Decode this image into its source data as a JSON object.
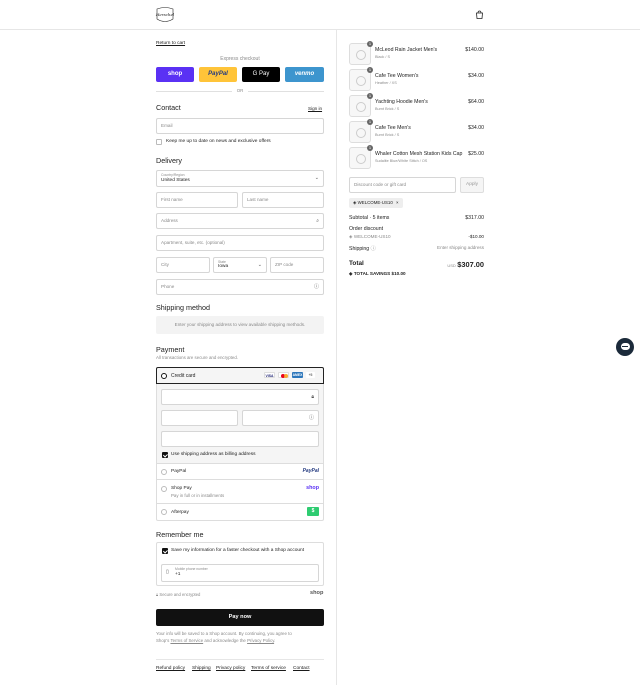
{
  "header": {
    "logo_text": "Herschel",
    "cart_icon": "bag-icon"
  },
  "nav": {
    "return_link": "Return to cart"
  },
  "express": {
    "label": "Express checkout",
    "buttons": {
      "shop": "shop",
      "paypal": "PayPal",
      "gpay": "G Pay",
      "venmo": "venmo"
    },
    "divider": "OR"
  },
  "contact": {
    "title": "Contact",
    "sign_in": "Sign in",
    "email_placeholder": "Email",
    "newsletter_label": "Keep me up to date on news and exclusive offers"
  },
  "delivery": {
    "title": "Delivery",
    "country_label": "Country/Region",
    "country_value": "United States",
    "first_name": "First name",
    "last_name": "Last name",
    "address": "Address",
    "apartment": "Apartment, suite, etc. (optional)",
    "city": "City",
    "state_label": "State",
    "state_value": "Iowa",
    "zip": "ZIP code",
    "phone": "Phone"
  },
  "shipping_method": {
    "title": "Shipping method",
    "notice": "Enter your shipping address to view available shipping methods."
  },
  "payment": {
    "title": "Payment",
    "subtitle": "All transactions are secure and encrypted.",
    "credit_card": "Credit card",
    "card_badges": [
      "VISA",
      "MC",
      "AMEX",
      "+5"
    ],
    "billing_same": "Use shipping address as billing address",
    "paypal": "PayPal",
    "paypal_logo": "PayPal",
    "shop_pay": "Shop Pay",
    "shop_pay_sub": "Pay in full or in installments",
    "shop_logo": "shop",
    "afterpay": "Afterpay",
    "afterpay_logo": "$"
  },
  "remember": {
    "title": "Remember me",
    "save_label": "Save my information for a faster checkout with a Shop account",
    "mobile_label": "Mobile phone number",
    "mobile_value": "+1",
    "secure_note": "Secure and encrypted",
    "shop_mark": "shop"
  },
  "pay_button": "Pay now",
  "legal": {
    "line1": "Your info will be saved to a Shop account. By continuing, you agree to",
    "line2_pre": "Shop's ",
    "terms": "Terms of Service",
    "line2_mid": " and acknowledge the ",
    "privacy": "Privacy Policy",
    "line2_end": "."
  },
  "footer_links": [
    "Refund policy",
    "Shipping",
    "Privacy policy",
    "Terms of service",
    "Contact"
  ],
  "cart": {
    "items": [
      {
        "name": "McLeod Rain Jacket Men's",
        "variant": "Black / S",
        "price": "$140.00",
        "qty": "1"
      },
      {
        "name": "Cafe Tee Women's",
        "variant": "Heather / XS",
        "price": "$34.00",
        "qty": "1"
      },
      {
        "name": "Yachting Hoodie Men's",
        "variant": "Burnt Brick / S",
        "price": "$64.00",
        "qty": "1"
      },
      {
        "name": "Cafe Tee Men's",
        "variant": "Burnt Brick / S",
        "price": "$34.00",
        "qty": "1"
      },
      {
        "name": "Whaler Cotton Mesh Station Kids Cap",
        "variant": "Sudalite Blue/White Stitch / OS",
        "price": "$25.00",
        "qty": "1"
      }
    ],
    "discount_placeholder": "Discount code or gift card",
    "apply": "Apply",
    "code_tag": "WELCOME-US10",
    "subtotal_label": "Subtotal · 5 items",
    "subtotal": "$317.00",
    "order_discount": "Order discount",
    "discount_code": "WELCOME-US10",
    "discount_amount": "-$10.00",
    "shipping_label": "Shipping",
    "shipping_value": "Enter shipping address",
    "total_label": "Total",
    "currency": "USD",
    "total": "$307.00",
    "savings_label": "TOTAL SAVINGS",
    "savings": "$10.00"
  },
  "chat_icon": "chat-bubble-icon",
  "colors": {
    "shop": "#5a31f4",
    "paypal": "#ffc439",
    "gpay": "#000000",
    "venmo": "#3d95ce",
    "afterpay": "#2ecc71",
    "pay_button": "#111111"
  }
}
